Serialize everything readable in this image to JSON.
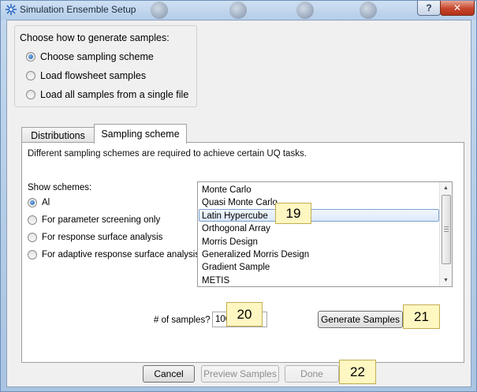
{
  "window": {
    "title": "Simulation Ensemble Setup",
    "help_label": "?",
    "close_label": "✕"
  },
  "generate_group": {
    "title": "Choose how to generate samples:",
    "options": [
      {
        "label": "Choose sampling scheme",
        "checked": true
      },
      {
        "label": "Load flowsheet samples",
        "checked": false
      },
      {
        "label": "Load all samples from a single file",
        "checked": false
      }
    ]
  },
  "tabs": [
    {
      "label": "Distributions",
      "active": false
    },
    {
      "label": "Sampling scheme",
      "active": true
    }
  ],
  "panel": {
    "description": "Different sampling schemes are required to achieve certain UQ tasks.",
    "show_label": "Show schemes:",
    "filters": [
      {
        "label": "Al",
        "checked": true
      },
      {
        "label": "For parameter screening only",
        "checked": false
      },
      {
        "label": "For response surface analysis",
        "checked": false
      },
      {
        "label": "For adaptive response surface analysis",
        "checked": false
      }
    ],
    "schemes": [
      "Monte Carlo",
      "Quasi Monte Carlo",
      "Latin Hypercube",
      "Orthogonal Array",
      "Morris Design",
      "Generalized Morris Design",
      "Gradient Sample",
      "METIS"
    ],
    "selected_scheme": "Latin Hypercube",
    "samples_label": "# of samples?",
    "samples_value": "100",
    "generate_label": "Generate Samples"
  },
  "footer": {
    "cancel_label": "Cancel",
    "preview_label": "Preview Samples",
    "done_label": "Done"
  },
  "callouts": [
    "19",
    "20",
    "21",
    "22"
  ],
  "colors": {
    "selection_border": "#7da2ce",
    "callout_bg": "#fff7c2",
    "close_red": "#c7452b",
    "radio_dot": "#1e5aa8"
  }
}
